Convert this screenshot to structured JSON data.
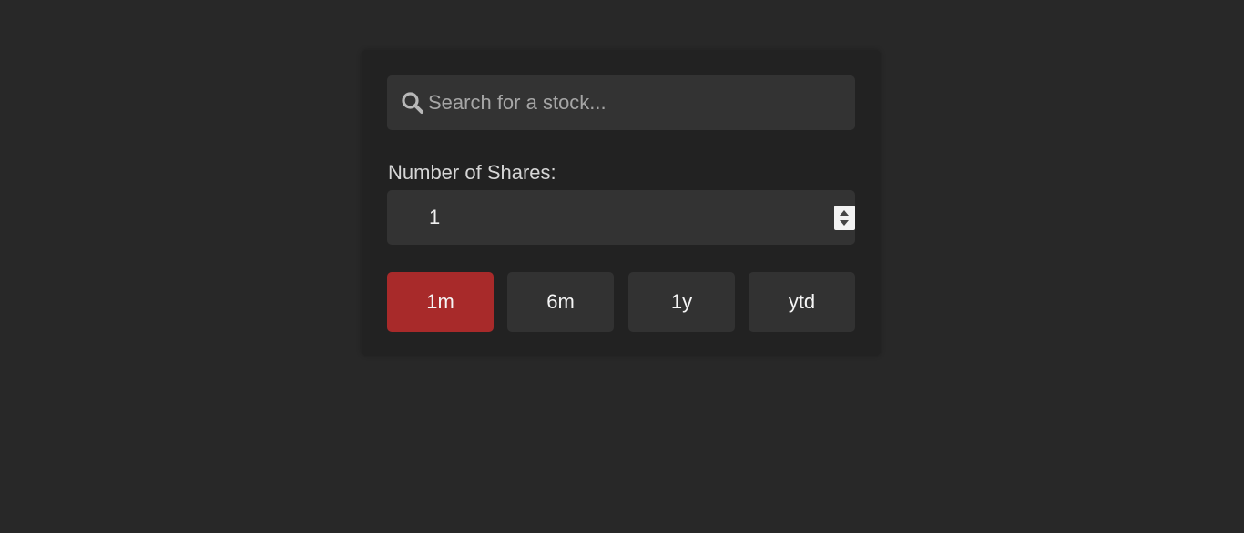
{
  "search": {
    "placeholder": "Search for a stock...",
    "value": ""
  },
  "shares": {
    "label": "Number of Shares:",
    "value": "1"
  },
  "ranges": [
    {
      "label": "1m",
      "active": true
    },
    {
      "label": "6m",
      "active": false
    },
    {
      "label": "1y",
      "active": false
    },
    {
      "label": "ytd",
      "active": false
    }
  ],
  "colors": {
    "background": "#282828",
    "panel": "#222222",
    "field": "#333333",
    "accent": "#a82a2a"
  },
  "icons": {
    "search": "search-icon",
    "stepper": "stepper-icon"
  }
}
